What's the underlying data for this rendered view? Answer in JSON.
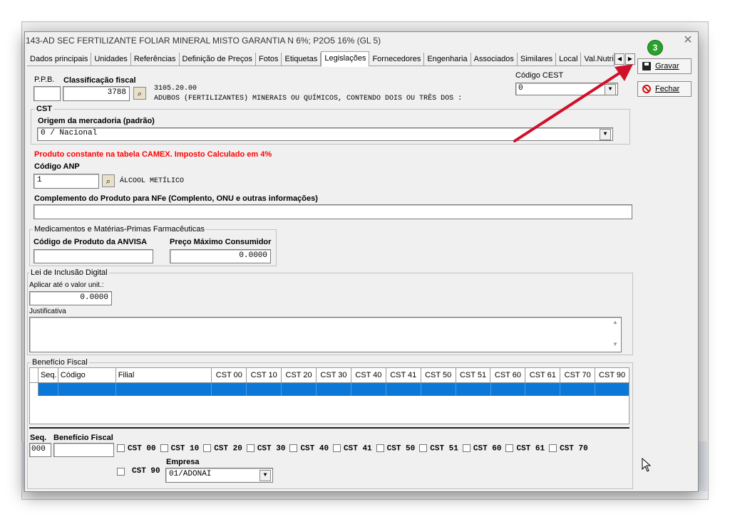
{
  "window": {
    "title": "143-AD SEC FERTILIZANTE FOLIAR MINERAL MISTO GARANTIA N 6%; P2O5 16% (GL 5)"
  },
  "tabs": [
    "Dados principais",
    "Unidades",
    "Referências",
    "Definição de Preços",
    "Fotos",
    "Etiquetas",
    "Legislações",
    "Fornecedores",
    "Engenharia",
    "Associados",
    "Similares",
    "Local",
    "Val.Nutric"
  ],
  "active_tab": "Legislações",
  "ppb": {
    "label": "P.P.B.",
    "value": ""
  },
  "classificacao": {
    "label": "Classificação fiscal",
    "value": "3788",
    "code": "3105.20.00",
    "description": "ADUBOS (FERTILIZANTES) MINERAIS OU QUÍMICOS, CONTENDO DOIS OU TRÊS DOS :"
  },
  "cest": {
    "label": "Código CEST",
    "value": "0"
  },
  "cst": {
    "group": "CST",
    "origem_label": "Origem da mercadoria (padrão)",
    "origem_value": "0 / Nacional"
  },
  "camex_notice": "Produto constante na tabela CAMEX. Imposto Calculado em 4%",
  "anp": {
    "label": "Código ANP",
    "value": "1",
    "description": "ÁLCOOL METÍLICO"
  },
  "complemento": {
    "label": "Complemento do Produto para NFe (Complento, ONU e outras informações)",
    "value": ""
  },
  "medicamentos": {
    "group": "Medicamentos e Matérias-Primas Farmacêuticas",
    "anvisa_label": "Código de Produto da ANVISA",
    "anvisa_value": "",
    "pmc_label": "Preço Máximo Consumidor",
    "pmc_value": "0.0000"
  },
  "lei": {
    "group": "Lei de Inclusão Digital",
    "valor_label": "Aplicar até o valor unit.:",
    "valor_value": "0.0000",
    "justificativa_label": "Justificativa",
    "justificativa_value": ""
  },
  "beneficio": {
    "group": "Benefício Fiscal",
    "columns": [
      "Seq.",
      "Código",
      "Filial",
      "CST 00",
      "CST 10",
      "CST 20",
      "CST 30",
      "CST 40",
      "CST 41",
      "CST 50",
      "CST 51",
      "CST 60",
      "CST 61",
      "CST 70",
      "CST 90"
    ],
    "seq_label": "Seq.",
    "seq_value": "000",
    "beneficio_label": "Benefício Fiscal",
    "beneficio_value": "",
    "cst_checks": [
      "CST 00",
      "CST 10",
      "CST 20",
      "CST 30",
      "CST 40",
      "CST 41",
      "CST 50",
      "CST 51",
      "CST 60",
      "CST 61",
      "CST 70"
    ],
    "cst_90": "CST 90",
    "empresa_label": "Empresa",
    "empresa_value": "01/ADONAI"
  },
  "buttons": {
    "gravar": "Gravar",
    "fechar": "Fechar"
  },
  "annotation": {
    "badge": "3",
    "arrow_color": "#d0102a"
  },
  "colors": {
    "accent": "#0b78d7",
    "warning": "#ff0000",
    "badge": "#2ca02c"
  }
}
